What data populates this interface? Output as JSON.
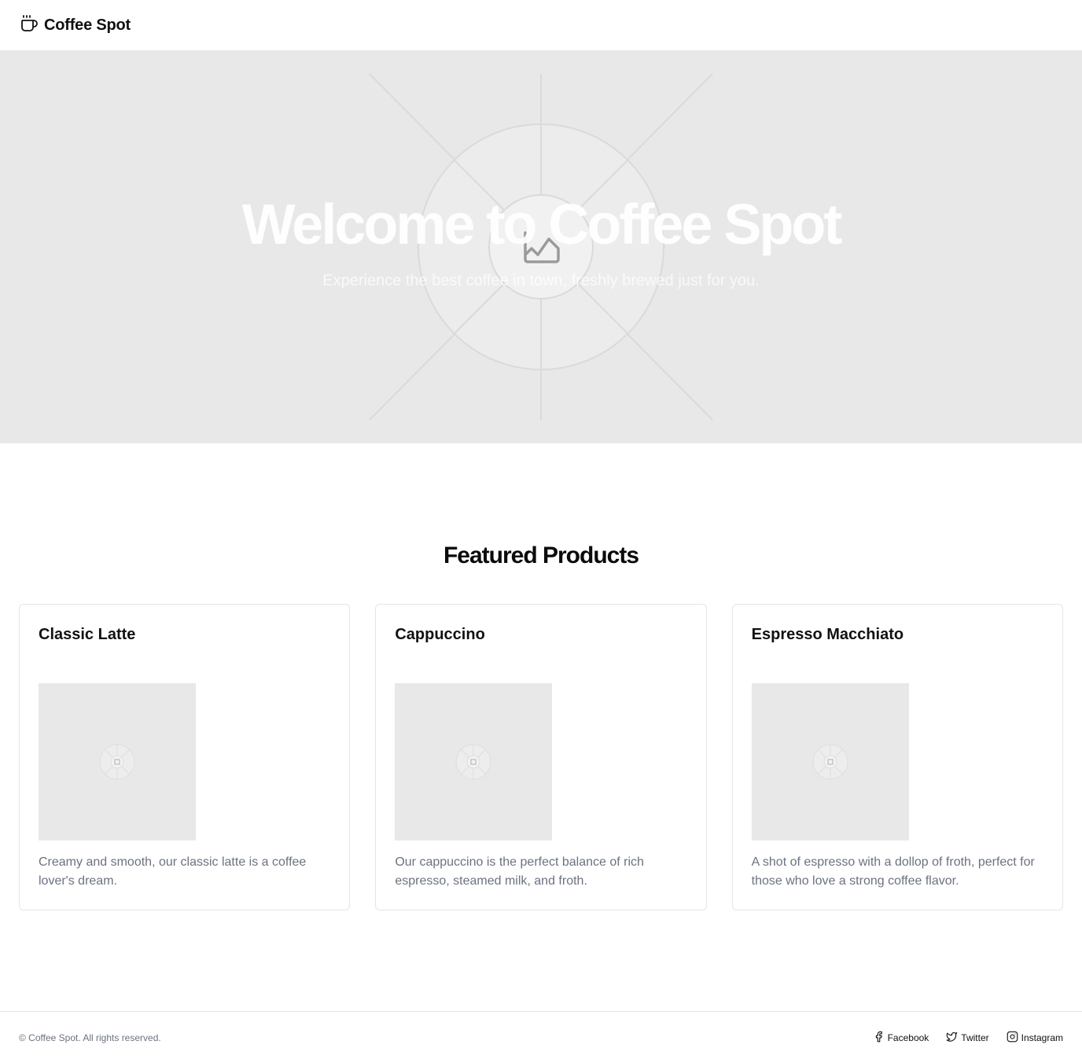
{
  "header": {
    "brand": "Coffee Spot",
    "brand_icon": "coffee-cup-icon"
  },
  "hero": {
    "title": "Welcome to Coffee Spot",
    "subtitle": "Experience the best coffee in town, freshly brewed just for you.",
    "image_icon": "image-placeholder-icon",
    "background": "#e8e8e8"
  },
  "featured": {
    "title": "Featured Products",
    "products": [
      {
        "name": "Classic Latte",
        "description": "Creamy and smooth, our classic latte is a coffee lover's dream."
      },
      {
        "name": "Cappuccino",
        "description": "Our cappuccino is the perfect balance of rich espresso, steamed milk, and froth."
      },
      {
        "name": "Espresso Macchiato",
        "description": "A shot of espresso with a dollop of froth, perfect for those who love a strong coffee flavor."
      }
    ]
  },
  "footer": {
    "copyright": "© Coffee Spot. All rights reserved.",
    "links": [
      {
        "label": "Facebook",
        "icon": "facebook-icon"
      },
      {
        "label": "Twitter",
        "icon": "twitter-icon"
      },
      {
        "label": "Instagram",
        "icon": "instagram-icon"
      }
    ]
  },
  "colors": {
    "muted_text": "#6b7280",
    "border": "#e5e5e5",
    "placeholder_bg": "#e8e8e8"
  }
}
